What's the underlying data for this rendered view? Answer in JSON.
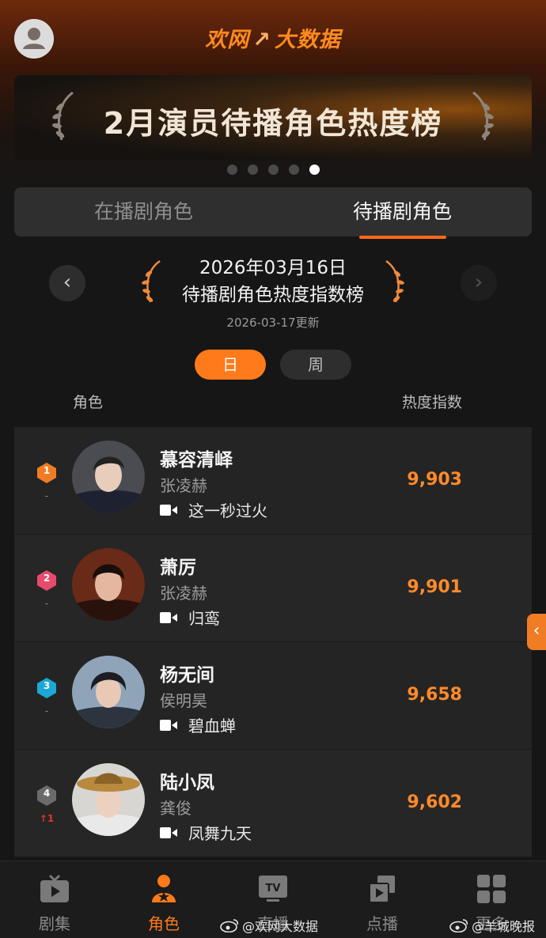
{
  "header": {
    "brand_left": "欢网",
    "brand_mark": "↗",
    "brand_right": "大数据"
  },
  "banner": {
    "title": "2月演员待播角色热度榜",
    "dot_count": 5,
    "active_dot": 4
  },
  "tabs": [
    {
      "label": "在播剧角色",
      "active": false
    },
    {
      "label": "待播剧角色",
      "active": true
    }
  ],
  "ranking_header": {
    "date": "2026年03月16日",
    "title": "待播剧角色热度指数榜",
    "updated": "2026-03-17更新",
    "prev_icon": "‹",
    "next_icon": "›"
  },
  "period": {
    "day": "日",
    "week": "周",
    "selected": "日"
  },
  "columns": {
    "role": "角色",
    "score": "热度指数"
  },
  "rows": [
    {
      "rank": "1",
      "change": "-",
      "change_dir": "none",
      "badge_color": "#f07d24",
      "role": "慕容清峄",
      "actor": "张凌赫",
      "drama": "这一秒过火",
      "score": "9,903"
    },
    {
      "rank": "2",
      "change": "-",
      "change_dir": "none",
      "badge_color": "#e84a6d",
      "role": "萧厉",
      "actor": "张凌赫",
      "drama": "归鸾",
      "score": "9,901"
    },
    {
      "rank": "3",
      "change": "-",
      "change_dir": "none",
      "badge_color": "#1ba8d8",
      "role": "杨无间",
      "actor": "侯明昊",
      "drama": "碧血蝉",
      "score": "9,658"
    },
    {
      "rank": "4",
      "change": "↑1",
      "change_dir": "up",
      "badge_color": "#6b6b6b",
      "role": "陆小凤",
      "actor": "龚俊",
      "drama": "凤舞九天",
      "score": "9,602"
    }
  ],
  "side_tab_icon": "‹",
  "bottom_nav": [
    {
      "label": "剧集",
      "icon": "tv-play-icon",
      "active": false
    },
    {
      "label": "角色",
      "icon": "person-star-icon",
      "active": true
    },
    {
      "label": "直播",
      "icon": "tv-live-icon",
      "active": false
    },
    {
      "label": "点播",
      "icon": "vod-icon",
      "active": false
    },
    {
      "label": "更多",
      "icon": "grid-icon",
      "active": false
    }
  ],
  "watermarks": {
    "left": "@欢网大数据",
    "right": "@羊城晚报"
  },
  "colors": {
    "accent": "#ff7a1a",
    "score": "#ff8a2a",
    "background": "#161616"
  }
}
